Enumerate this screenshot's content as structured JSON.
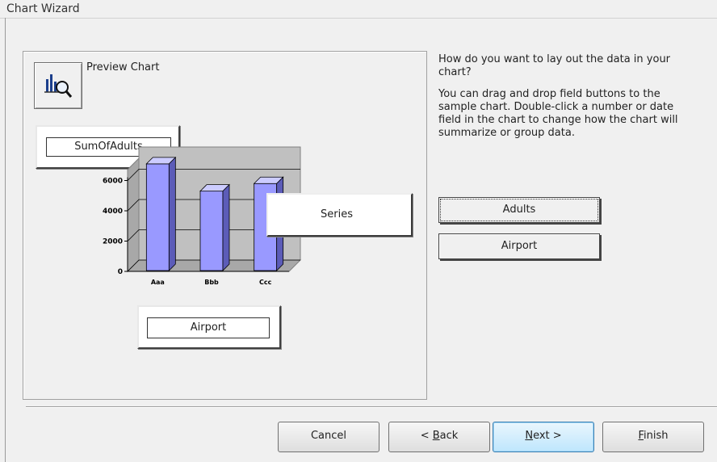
{
  "window": {
    "title": "Chart Wizard"
  },
  "preview": {
    "label": "Preview Chart",
    "icon": "chart-preview-icon"
  },
  "layout": {
    "data_field": "SumOfAdults",
    "axis_field": "Airport",
    "series_field": "Series"
  },
  "chart_data": {
    "type": "bar",
    "categories": [
      "Aaa",
      "Bbb",
      "Ccc"
    ],
    "values": [
      7100,
      5300,
      5800
    ],
    "yticks": [
      0,
      2000,
      4000,
      6000
    ],
    "ylim": [
      0,
      8000
    ],
    "bar_color": "#9999ff"
  },
  "instructions": {
    "question": "How do you want to lay out the data in your chart?",
    "help": "You can drag and drop field buttons to the sample chart. Double-click a number or date field in the chart to change how the chart will summarize or group data."
  },
  "fields": [
    {
      "label": "Adults"
    },
    {
      "label": "Airport"
    }
  ],
  "buttons": {
    "cancel": "Cancel",
    "back_prefix": "< ",
    "back_access": "B",
    "back_rest": "ack",
    "next_access": "N",
    "next_rest": "ext >",
    "finish_access": "F",
    "finish_rest": "inish"
  }
}
